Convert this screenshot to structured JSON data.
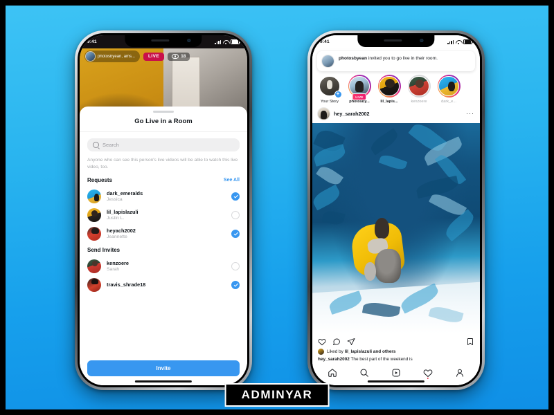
{
  "watermark": {
    "text": "ADMINYAR"
  },
  "left_phone": {
    "status": {
      "time": "9:41"
    },
    "live": {
      "participants_label": "photosbyean, ams...",
      "live_badge": "LIVE",
      "viewers": "18"
    },
    "sheet": {
      "title": "Go Live in a Room",
      "search_placeholder": "Search",
      "helper_text": "Anyone who can see this person's live videos will be able to watch this live video, too.",
      "sections": [
        {
          "title": "Requests",
          "action_label": "See All",
          "people": [
            {
              "username": "dark_emeralds",
              "realname": "Jessica",
              "selected": true
            },
            {
              "username": "lil_lapislazuli",
              "realname": "Justin L.",
              "selected": false
            },
            {
              "username": "heyach2002",
              "realname": "Jeannette",
              "selected": true
            }
          ]
        },
        {
          "title": "Send Invites",
          "action_label": "",
          "people": [
            {
              "username": "kenzoere",
              "realname": "Sarah",
              "selected": false
            },
            {
              "username": "travis_shrade18",
              "realname": "",
              "selected": true
            }
          ]
        }
      ],
      "cta_label": "Invite"
    }
  },
  "right_phone": {
    "status": {
      "time": "9:41"
    },
    "notification": {
      "actor": "photosbyean",
      "text": " invited you to go live in their room."
    },
    "stories": [
      {
        "label": "Your Story",
        "ring": "plain",
        "badge": "plus"
      },
      {
        "label": "photosby...",
        "ring": "grad",
        "badge": "LIVE"
      },
      {
        "label": "lil_lapis...",
        "ring": "grad",
        "badge": ""
      },
      {
        "label": "kenzoere",
        "ring": "seen",
        "badge": ""
      },
      {
        "label": "dark_e...",
        "ring": "grad",
        "badge": ""
      }
    ],
    "post": {
      "author": "hey_sarah2002",
      "menu": "···",
      "likes_prefix": "Liked by ",
      "likes_user": "lil_lapislazuli",
      "likes_suffix": " and others",
      "caption_author": "hey_sarah2002",
      "caption_text": " The best part of the weekend is"
    },
    "nav": [
      {
        "name": "home"
      },
      {
        "name": "search"
      },
      {
        "name": "reels"
      },
      {
        "name": "activity"
      },
      {
        "name": "profile"
      }
    ]
  },
  "colors": {
    "accent_blue": "#3897f0",
    "background_top": "#3dc3f5",
    "background_bottom": "#0f8fe6",
    "live_red": "#c9104a"
  }
}
